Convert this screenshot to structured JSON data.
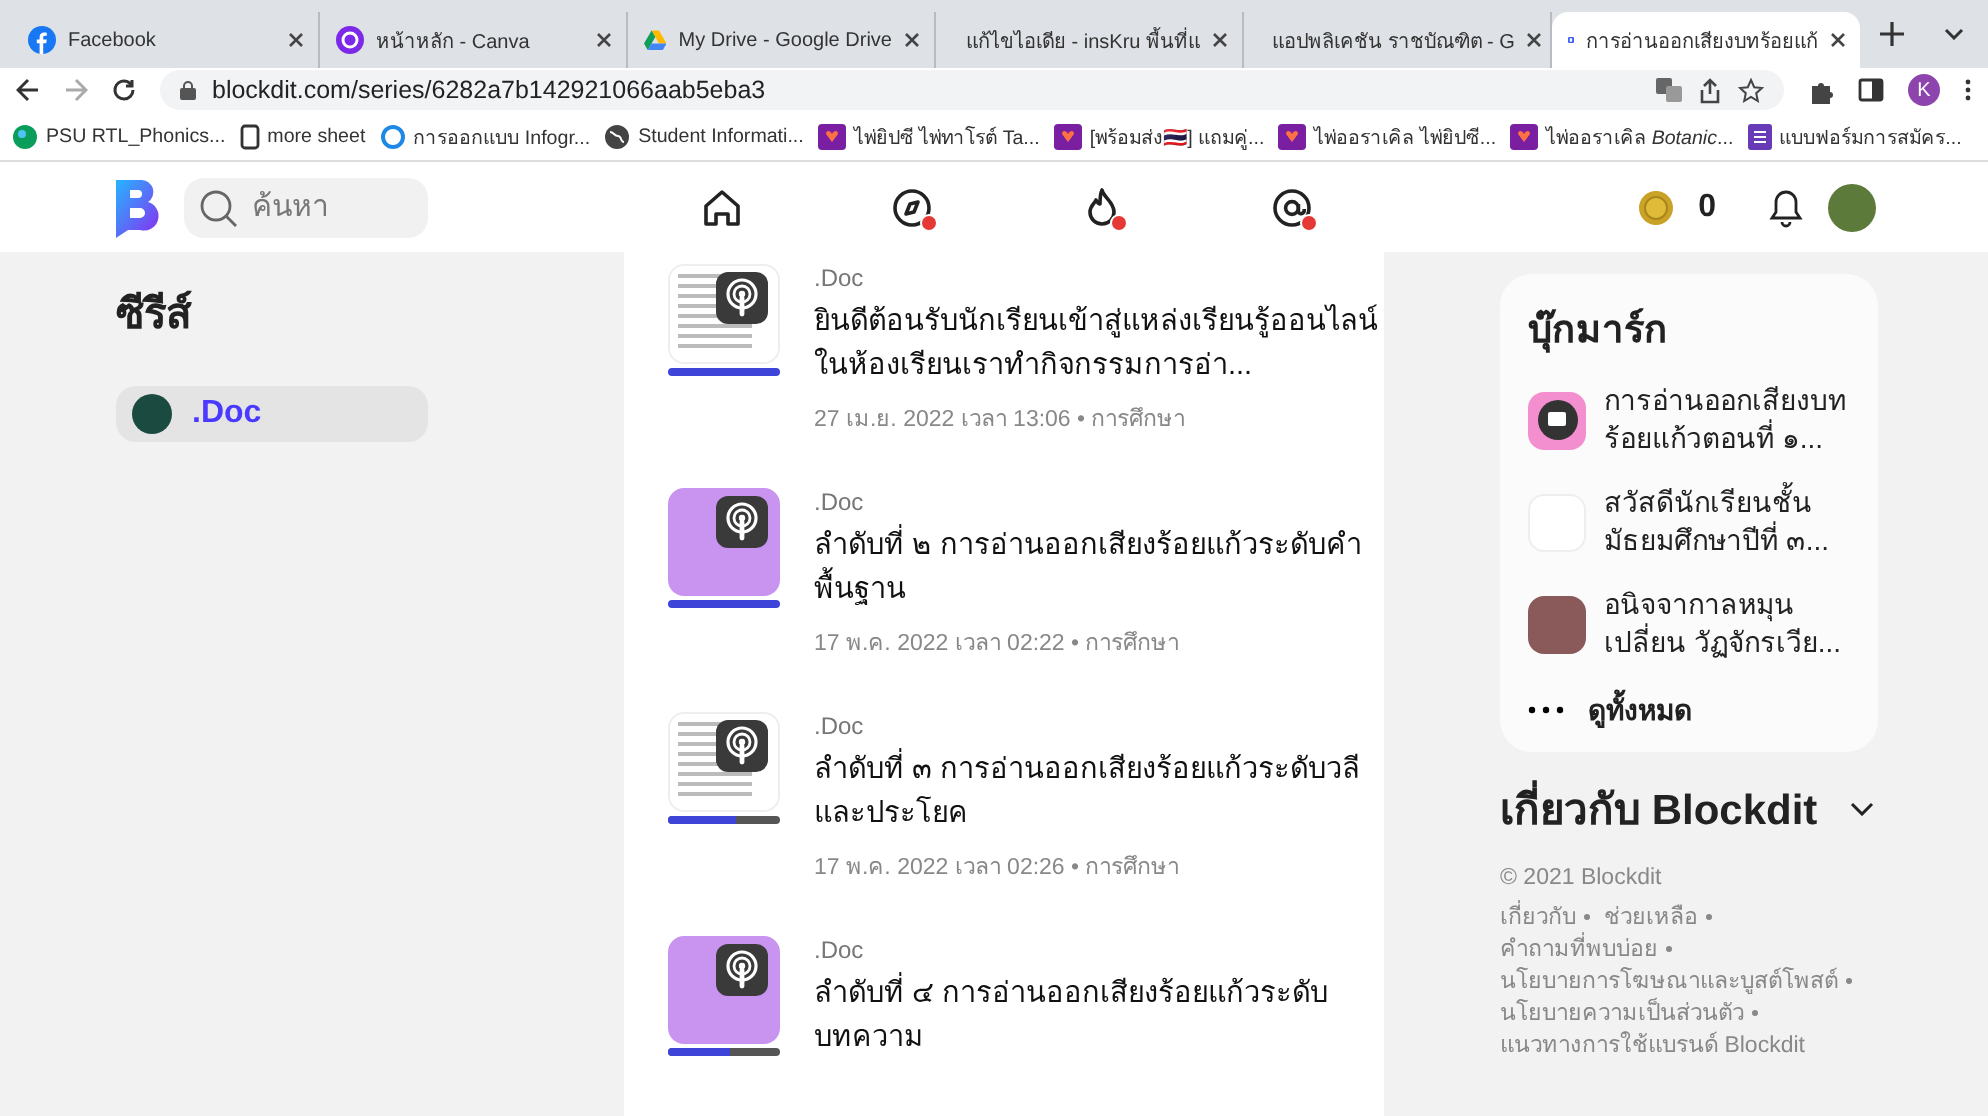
{
  "browser": {
    "tabs": [
      {
        "title": "Facebook",
        "selected": false
      },
      {
        "title": "หน้าหลัก - Canva",
        "selected": false
      },
      {
        "title": "My Drive - Google Drive",
        "selected": false
      },
      {
        "title": "แก้ไขไอเดีย - insKru พื้นที่แ",
        "selected": false
      },
      {
        "title": "แอปพลิเคชัน ราชบัณฑิต - G",
        "selected": false
      },
      {
        "title": "การอ่านออกเสียงบทร้อยแก้",
        "selected": true
      }
    ],
    "url": "blockdit.com/series/6282a7b142921066aab5eba3",
    "profile_initial": "K",
    "bookmarks": [
      {
        "label": "PSU RTL_Phonics..."
      },
      {
        "label": "more sheet"
      },
      {
        "label": "การออกแบบ Infogr..."
      },
      {
        "label": "Student Informati..."
      },
      {
        "label": "ไพ่ยิปซี ไพ่ทาโรต์ Ta..."
      },
      {
        "label": "[พร้อมส่ง🇹🇭] แถมคู่..."
      },
      {
        "label": "ไพ่ออราเคิล ไพ่ยิปซี..."
      },
      {
        "label": "ไพ่ออราเคิล *Botanic*..."
      },
      {
        "label": "แบบฟอร์มการสมัคร..."
      }
    ]
  },
  "header": {
    "search": {
      "placeholder": "ค้นหา"
    },
    "nav": [
      {
        "badge": false
      },
      {
        "badge": true
      },
      {
        "badge": true
      },
      {
        "badge": true
      }
    ],
    "coins": "0"
  },
  "sidebar": {
    "title": "ซีรีส์",
    "items": [
      {
        "label": ".Doc",
        "selected": true
      }
    ]
  },
  "feed": [
    {
      "series": ".Doc",
      "title": "ยินดีต้อนรับนักเรียนเข้าสู่แหล่งเรียนรู้ออนไลน์ ในห้องเรียนเราทำกิจกรรมการอ่า...",
      "meta": "27 เม.ย. 2022 เวลา 13:06 • การศึกษา",
      "kind": "document",
      "level": 1
    },
    {
      "series": ".Doc",
      "title": "ลำดับที่ ๒ การอ่านออกเสียงร้อยแก้วระดับคำพื้นฐาน",
      "meta": "17 พ.ค. 2022 เวลา 02:22 • การศึกษา",
      "kind": "cover",
      "level": 1
    },
    {
      "series": ".Doc",
      "title": "ลำดับที่ ๓ การอ่านออกเสียงร้อยแก้วระดับวลีและประโยค",
      "meta": "17 พ.ค. 2022 เวลา 02:26 • การศึกษา",
      "kind": "document",
      "level": 0.6
    },
    {
      "series": ".Doc",
      "title": "ลำดับที่ ๔ การอ่านออกเสียงร้อยแก้วระดับบทความ",
      "kind": "cover",
      "level": 0.55
    }
  ],
  "bookmarks_card": {
    "title": "บุ๊กมาร์ก",
    "items": [
      {
        "title": "การอ่านออกเสียงบทร้อยแก้วตอนที่ ๑...",
        "kind": "cover"
      },
      {
        "title": "สวัสดีนักเรียนชั้นมัธยมศึกษาปีที่ ๓...",
        "kind": "document"
      },
      {
        "title": "อนิจจากาลหมุนเปลี่ยน วัฏจักรเวีย...",
        "kind": "photo"
      }
    ],
    "more": "ดูทั้งหมด"
  },
  "about": {
    "title": "เกี่ยวกับ Blockdit",
    "copyright": "© 2021 Blockdit",
    "links": [
      "เกี่ยวกับ",
      "ช่วยเหลือ",
      "คำถามที่พบบ่อย",
      "นโยบายการโฆษณาและบูสต์โพสต์",
      "นโยบายความเป็นส่วนตัว",
      "แนวทางการใช้แบรนด์ Blockdit"
    ]
  }
}
